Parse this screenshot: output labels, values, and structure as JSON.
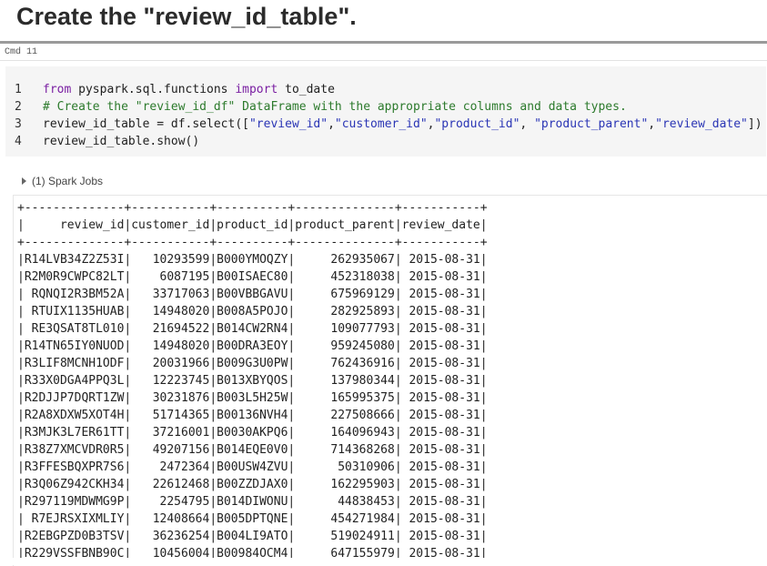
{
  "heading": "Create the \"review_id_table\".",
  "cell": {
    "cmd_label": "Cmd 11",
    "code_lines": [
      {
        "num": "1",
        "parts": [
          {
            "t": "from",
            "c": "kw"
          },
          {
            "t": " pyspark.sql.functions ",
            "c": ""
          },
          {
            "t": "import",
            "c": "kw"
          },
          {
            "t": " to_date",
            "c": ""
          }
        ]
      },
      {
        "num": "2",
        "parts": [
          {
            "t": "# Create the \"review_id_df\" DataFrame with the appropriate columns and data types.",
            "c": "cm"
          }
        ]
      },
      {
        "num": "3",
        "parts": [
          {
            "t": "review_id_table = df.select([",
            "c": ""
          },
          {
            "t": "\"review_id\"",
            "c": "str"
          },
          {
            "t": ",",
            "c": ""
          },
          {
            "t": "\"customer_id\"",
            "c": "str"
          },
          {
            "t": ",",
            "c": ""
          },
          {
            "t": "\"product_id\"",
            "c": "str"
          },
          {
            "t": ", ",
            "c": ""
          },
          {
            "t": "\"product_parent\"",
            "c": "str"
          },
          {
            "t": ",",
            "c": ""
          },
          {
            "t": "\"review_date\"",
            "c": "str"
          },
          {
            "t": "])",
            "c": ""
          }
        ]
      },
      {
        "num": "4",
        "parts": [
          {
            "t": "review_id_table.show()",
            "c": ""
          }
        ]
      }
    ]
  },
  "spark_jobs_label": "(1) Spark Jobs",
  "output": {
    "separator": "+--------------+-----------+----------+--------------+-----------+",
    "header": "|     review_id|customer_id|product_id|product_parent|review_date|",
    "rows": [
      "|R14LVB34Z2Z53I|   10293599|B000YMOQZY|     262935067| 2015-08-31|",
      "|R2M0R9CWPC82LT|    6087195|B00ISAEC80|     452318038| 2015-08-31|",
      "| RQNQI2R3BM52A|   33717063|B00VBBGAVU|     675969129| 2015-08-31|",
      "| RTUIX1135HUAB|   14948020|B008A5POJO|     282925893| 2015-08-31|",
      "| RE3QSAT8TL010|   21694522|B014CW2RN4|     109077793| 2015-08-31|",
      "|R14TN65IY0NUOD|   14948020|B00DRA3EOY|     959245080| 2015-08-31|",
      "|R3LIF8MCNH1ODF|   20031966|B009G3U0PW|     762436916| 2015-08-31|",
      "|R33X0DGA4PPQ3L|   12223745|B013XBYQOS|     137980344| 2015-08-31|",
      "|R2DJJP7DQRT1ZW|   30231876|B003L5H25W|     165995375| 2015-08-31|",
      "|R2A8XDXW5XOT4H|   51714365|B00136NVH4|     227508666| 2015-08-31|",
      "|R3MJK3L7ER61TT|   37216001|B0030AKPQ6|     164096943| 2015-08-31|",
      "|R38Z7XMCVDR0R5|   49207156|B014EQE0V0|     714368268| 2015-08-31|",
      "|R3FFESBQXPR7S6|    2472364|B00USW4ZVU|      50310906| 2015-08-31|",
      "|R3Q06Z942CKH34|   22612468|B00ZZDJAX0|     162295903| 2015-08-31|",
      "|R297119MDWMG9P|    2254795|B014DIWONU|      44838453| 2015-08-31|",
      "| R7EJRSXIXMLIY|   12408664|B005DPTQNE|     454271984| 2015-08-31|",
      "|R2EBGPZD0B3TSV|   36236254|B004LI9ATO|     519024911| 2015-08-31|",
      "|R229VSSFBNB90C|   10456004|B00984OCM4|     647155979| 2015-08-31|"
    ]
  }
}
